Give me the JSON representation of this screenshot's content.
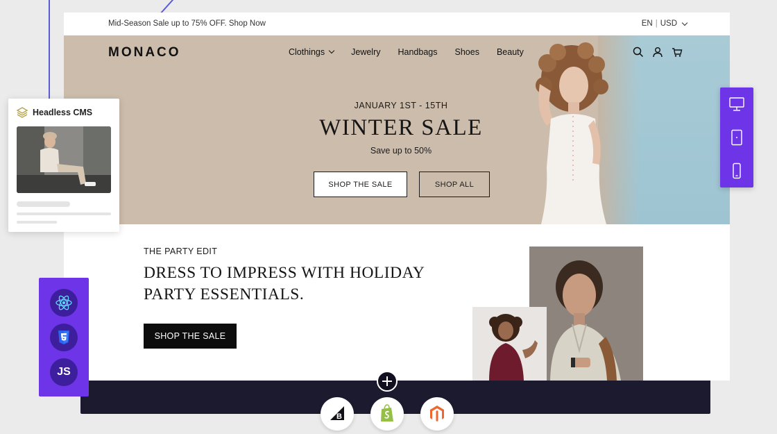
{
  "promo_bar": {
    "text": "Mid-Season Sale up to 75% OFF. Shop Now",
    "language": "EN",
    "currency": "USD"
  },
  "header": {
    "logo": "MONACO",
    "nav": [
      "Clothings",
      "Jewelry",
      "Handbags",
      "Shoes",
      "Beauty"
    ],
    "icons": [
      "search-icon",
      "account-icon",
      "cart-icon"
    ]
  },
  "hero": {
    "date": "JANUARY 1ST - 15TH",
    "title": "WINTER SALE",
    "subtitle": "Save up to 50%",
    "primary_button": "SHOP THE SALE",
    "secondary_button": "SHOP ALL"
  },
  "party": {
    "eyebrow": "THE PARTY EDIT",
    "title": "DRESS TO IMPRESS WITH HOLIDAY PARTY ESSENTIALS.",
    "button": "SHOP THE SALE"
  },
  "cms_card": {
    "title": "Headless CMS"
  },
  "device_panel": {
    "icons": [
      "desktop-icon",
      "tablet-icon",
      "mobile-icon"
    ]
  },
  "tech_panel": {
    "icons": [
      "react-icon",
      "css3-icon",
      "js-icon"
    ],
    "js_label": "JS"
  },
  "platforms": {
    "icons": [
      "bigcommerce-icon",
      "shopify-icon",
      "magento-icon"
    ]
  },
  "colors": {
    "accent_purple": "#6d34e8",
    "hero_beige": "#ccbcab",
    "hero_blue": "#a8cbd6",
    "dark_bar": "#1c1a2e"
  }
}
